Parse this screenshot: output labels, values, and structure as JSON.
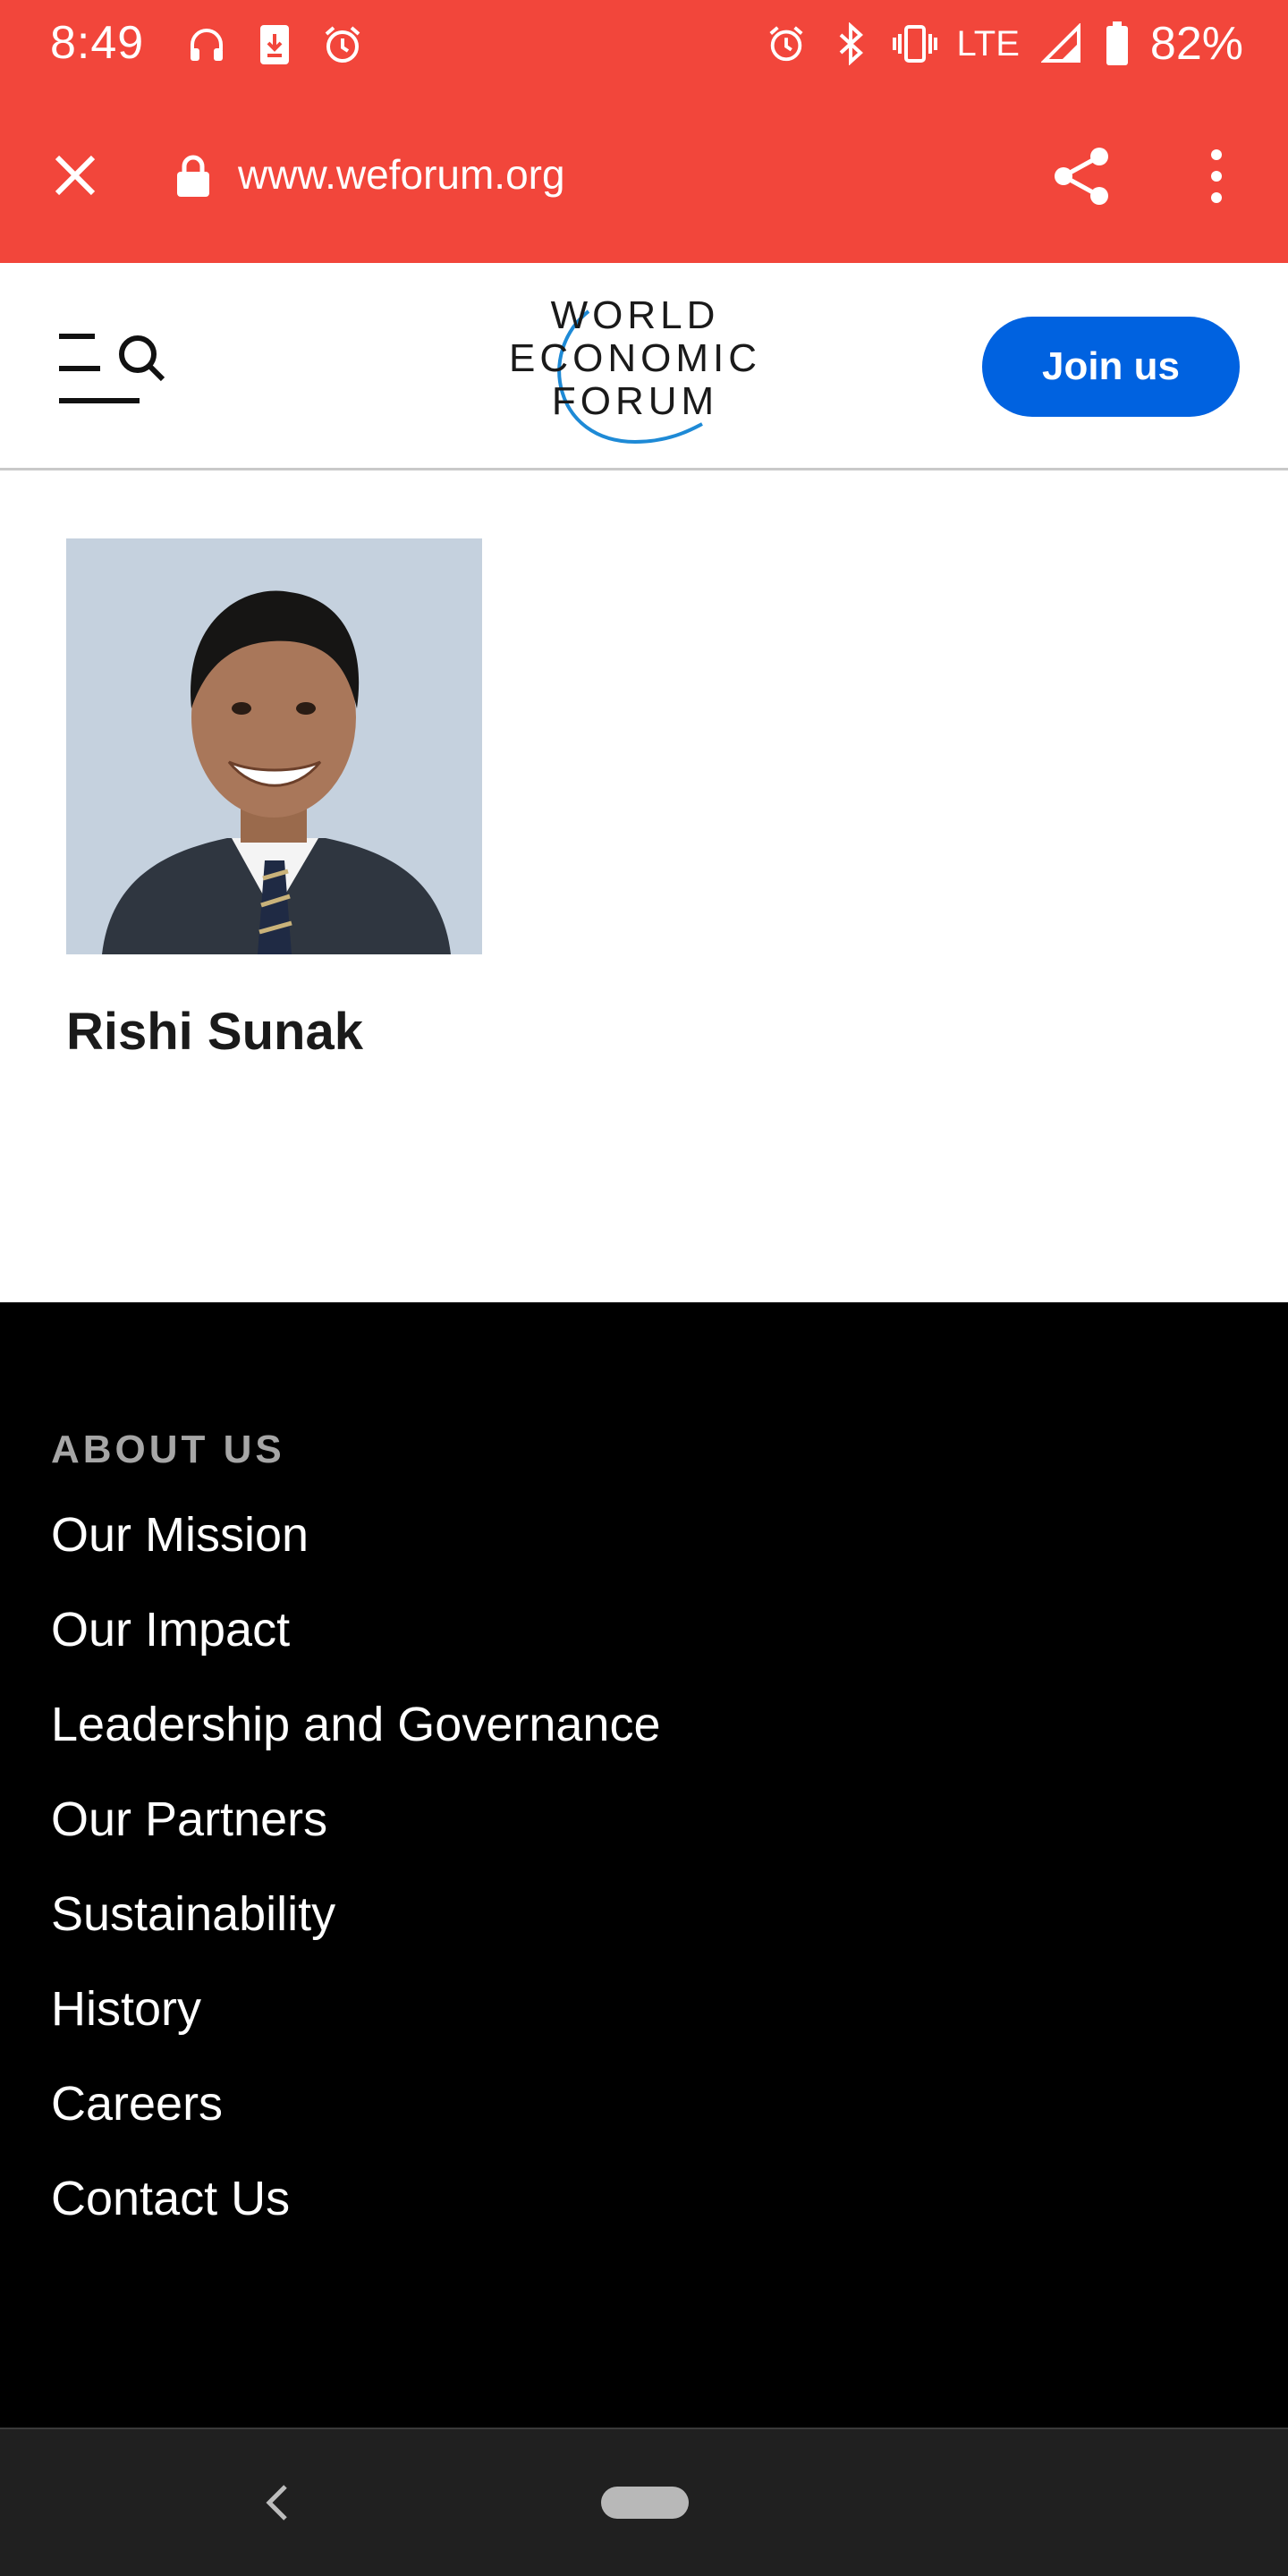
{
  "status_bar": {
    "time": "8:49",
    "left_icons": [
      "headset-notification-icon",
      "download-notification-icon",
      "alarm-icon"
    ],
    "right_icons": [
      "alarm-icon",
      "bluetooth-icon",
      "vibrate-icon",
      "signal-icon",
      "battery-icon"
    ],
    "network": "LTE",
    "battery": "82%"
  },
  "browser": {
    "url": "www.weforum.org",
    "icons": [
      "close-icon",
      "lock-icon",
      "share-icon",
      "more-vert-icon"
    ],
    "toolbar_color": "#f2463b"
  },
  "site_header": {
    "logo_lines": [
      "WORLD",
      "ECONOMIC",
      "FORUM"
    ],
    "join_button": "Join us",
    "join_color": "#0062e0",
    "menu_icon": "menu-search-icon"
  },
  "person": {
    "name": "Rishi Sunak"
  },
  "footer": {
    "heading": "ABOUT US",
    "links": [
      "Our Mission",
      "Our Impact",
      "Leadership and Governance",
      "Our Partners",
      "Sustainability",
      "History",
      "Careers",
      "Contact Us"
    ]
  },
  "nav_bar": {
    "icons": [
      "back-icon",
      "home-pill"
    ]
  }
}
